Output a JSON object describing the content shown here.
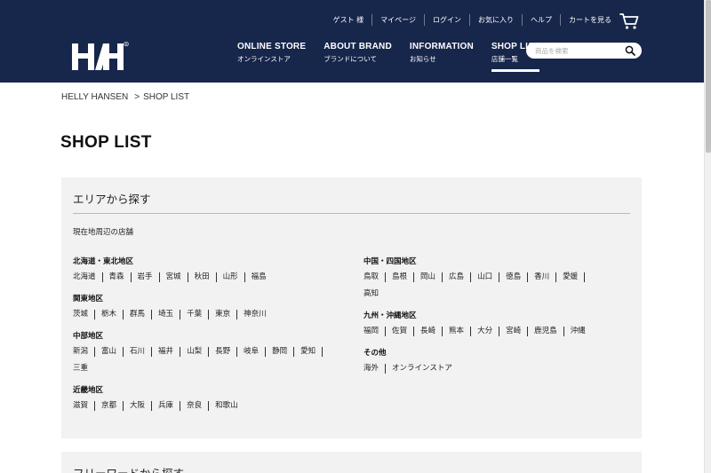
{
  "header": {
    "brand_name": "HH",
    "utility_links": [
      "ゲスト 様",
      "マイページ",
      "ログイン",
      "お気に入り",
      "ヘルプ",
      "カートを見る"
    ],
    "nav": [
      {
        "en": "ONLINE STORE",
        "jp": "オンラインストア",
        "active": false
      },
      {
        "en": "ABOUT BRAND",
        "jp": "ブランドについて",
        "active": false
      },
      {
        "en": "INFORMATION",
        "jp": "お知らせ",
        "active": false
      },
      {
        "en": "SHOP LIST",
        "jp": "店舗一覧",
        "active": true
      }
    ],
    "search": {
      "placeholder": "商品を検索",
      "value": ""
    },
    "icons": {
      "cart": "cart-icon",
      "search": "search-icon",
      "logo": "hh-logo"
    }
  },
  "breadcrumb": {
    "home": "HELLY HANSEN",
    "separator": ">",
    "current": "SHOP LIST"
  },
  "page_title": "SHOP LIST",
  "area_search": {
    "title": "エリアから探す",
    "nearby": "現在地周辺の店舗",
    "left": [
      {
        "name": "北海道・東北地区",
        "prefs": [
          "北海道",
          "青森",
          "岩手",
          "宮城",
          "秋田",
          "山形",
          "福島"
        ]
      },
      {
        "name": "関東地区",
        "prefs": [
          "茨城",
          "栃木",
          "群馬",
          "埼玉",
          "千葉",
          "東京",
          "神奈川"
        ]
      },
      {
        "name": "中部地区",
        "prefs": [
          "新潟",
          "富山",
          "石川",
          "福井",
          "山梨",
          "長野",
          "岐阜",
          "静岡",
          "愛知",
          "三重"
        ]
      },
      {
        "name": "近畿地区",
        "prefs": [
          "滋賀",
          "京都",
          "大阪",
          "兵庫",
          "奈良",
          "和歌山"
        ]
      }
    ],
    "right": [
      {
        "name": "中国・四国地区",
        "prefs": [
          "鳥取",
          "島根",
          "岡山",
          "広島",
          "山口",
          "徳島",
          "香川",
          "愛媛",
          "高知"
        ]
      },
      {
        "name": "九州・沖縄地区",
        "prefs": [
          "福岡",
          "佐賀",
          "長崎",
          "熊本",
          "大分",
          "宮崎",
          "鹿児島",
          "沖縄"
        ]
      },
      {
        "name": "その他",
        "prefs": [
          "海外",
          "オンラインストア"
        ]
      }
    ]
  },
  "freeword_search": {
    "title": "フリーワードから探す"
  },
  "colors": {
    "header_bg": "#17264b",
    "panel_bg": "#f2f2f2"
  }
}
